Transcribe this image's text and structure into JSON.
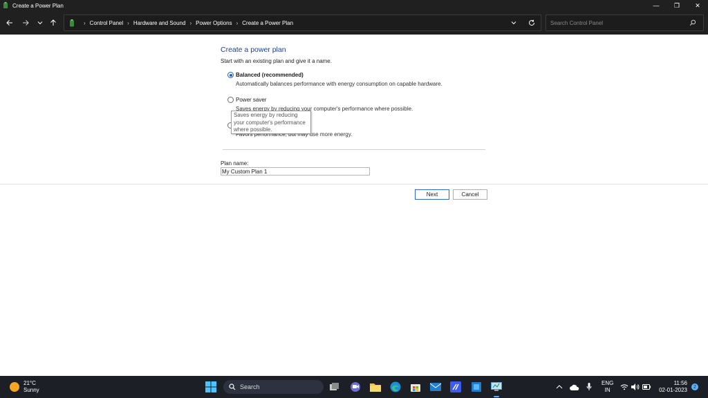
{
  "window": {
    "title": "Create a Power Plan",
    "controls": {
      "minimize": "—",
      "maximize": "❐",
      "close": "✕"
    }
  },
  "address_bar": {
    "breadcrumbs": [
      "Control Panel",
      "Hardware and Sound",
      "Power Options",
      "Create a Power Plan"
    ],
    "separator": "›",
    "search_placeholder": "Search Control Panel"
  },
  "content": {
    "heading": "Create a power plan",
    "intro": "Start with an existing plan and give it a name.",
    "plans": [
      {
        "label": "Balanced (recommended)",
        "description": "Automatically balances performance with energy consumption on capable hardware.",
        "selected": true
      },
      {
        "label": "Power saver",
        "description": "Saves energy by reducing your computer's performance where possible.",
        "selected": false
      },
      {
        "label": "",
        "description": "Favors performance, but may use more energy.",
        "selected": false
      }
    ],
    "tooltip": "Saves energy by reducing your computer's performance where possible.",
    "plan_name_label": "Plan name:",
    "plan_name_value": "My Custom Plan 1",
    "buttons": {
      "next": "Next",
      "cancel": "Cancel"
    }
  },
  "taskbar": {
    "weather": {
      "temp": "21°C",
      "condition": "Sunny"
    },
    "search_label": "Search",
    "language": {
      "line1": "ENG",
      "line2": "IN"
    },
    "clock": {
      "time": "11:56",
      "date": "02-01-2023"
    },
    "notification_count": "2",
    "pinned_icons": [
      "windows-start-icon",
      "task-view-icon",
      "teams-chat-icon",
      "file-explorer-icon",
      "edge-icon",
      "microsoft-store-icon",
      "mail-icon",
      "app-icon",
      "app-icon",
      "control-panel-icon"
    ]
  },
  "colors": {
    "accent": "#1f5fbf",
    "heading": "#1e3f8a",
    "titlebar": "#202020",
    "taskbar": "#1c1f26"
  }
}
